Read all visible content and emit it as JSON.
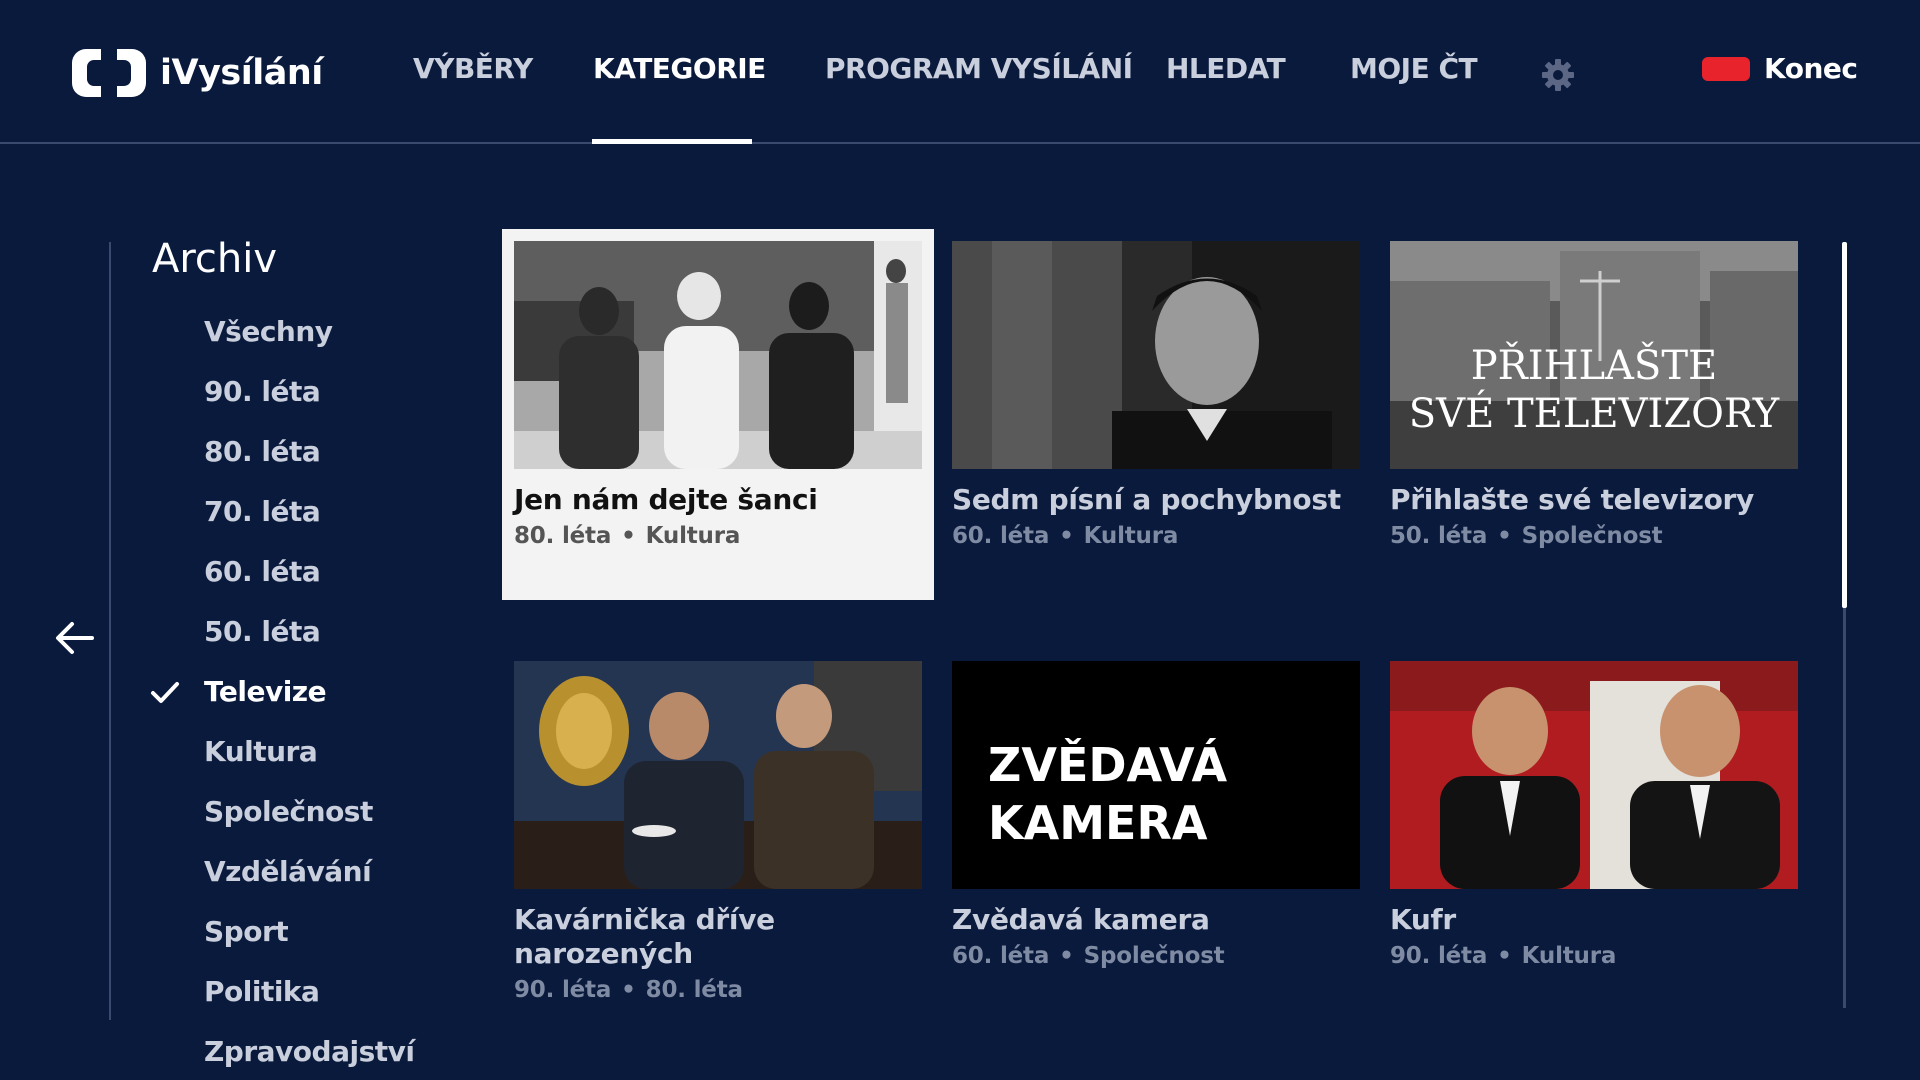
{
  "app": {
    "title": "iVysílání"
  },
  "nav": {
    "items": [
      {
        "label": "VÝBĚRY"
      },
      {
        "label": "KATEGORIE",
        "active": true
      },
      {
        "label": "PROGRAM VYSÍLÁNÍ"
      },
      {
        "label": "HLEDAT"
      },
      {
        "label": "MOJE ČT"
      }
    ],
    "settings_icon": "gear-icon",
    "exit": {
      "label": "Konec",
      "button_color": "#e8232b"
    }
  },
  "sidebar": {
    "title": "Archiv",
    "back_icon": "arrow-left-icon",
    "items": [
      {
        "label": "Všechny"
      },
      {
        "label": "90. léta"
      },
      {
        "label": "80. léta"
      },
      {
        "label": "70. léta"
      },
      {
        "label": "60. léta"
      },
      {
        "label": "50. léta"
      },
      {
        "label": "Televize",
        "selected": true
      },
      {
        "label": "Kultura"
      },
      {
        "label": "Společnost"
      },
      {
        "label": "Vzdělávání"
      },
      {
        "label": "Sport"
      },
      {
        "label": "Politika"
      },
      {
        "label": "Zpravodajství"
      }
    ]
  },
  "grid": {
    "cards": [
      {
        "title": "Jen nám dejte šanci",
        "tag1": "80. léta",
        "tag2": "Kultura",
        "focused": true
      },
      {
        "title": "Sedm písní a pochybnost",
        "tag1": "60. léta",
        "tag2": "Kultura"
      },
      {
        "title": "Přihlašte své televizory",
        "tag1": "50. léta",
        "tag2": "Společnost",
        "thumb_text_1": "PŘIHLAŠTE",
        "thumb_text_2": "SVÉ TELEVIZORY"
      },
      {
        "title": "Kavárnička dříve narozených",
        "tag1": "90. léta",
        "tag2": "80. léta"
      },
      {
        "title": "Zvědavá kamera",
        "tag1": "60. léta",
        "tag2": "Společnost",
        "thumb_text_1": "ZVĚDAVÁ",
        "thumb_text_2": "KAMERA"
      },
      {
        "title": "Kufr",
        "tag1": "90. léta",
        "tag2": "Kultura"
      }
    ]
  },
  "colors": {
    "background": "#0a1a3d",
    "text": "#c9cfdc",
    "muted": "#7f8aa3",
    "accent_red": "#e8232b"
  }
}
